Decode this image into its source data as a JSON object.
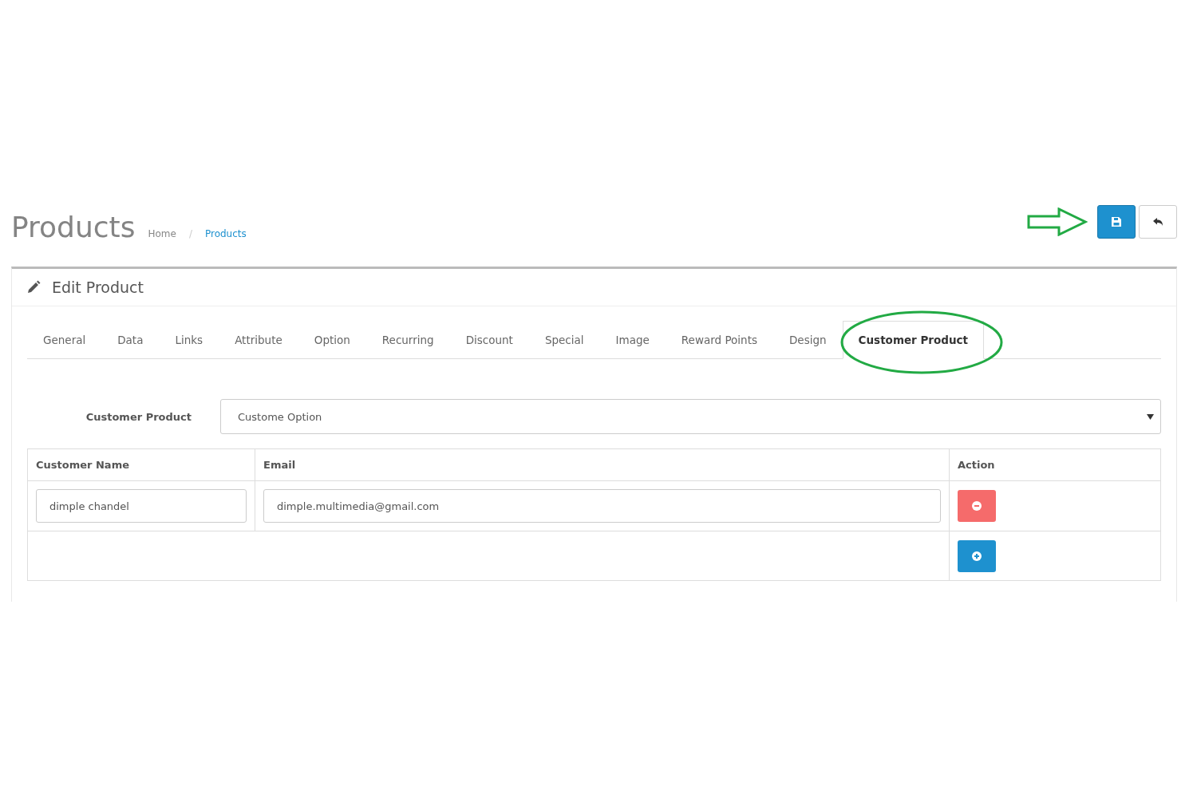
{
  "page": {
    "title": "Products",
    "breadcrumb_separator": "/",
    "breadcrumb": [
      {
        "label": "Home",
        "selected": false
      },
      {
        "label": "Products",
        "selected": true
      }
    ]
  },
  "panel": {
    "title": "Edit Product"
  },
  "tabs": [
    {
      "label": "General",
      "selected": false
    },
    {
      "label": "Data",
      "selected": false
    },
    {
      "label": "Links",
      "selected": false
    },
    {
      "label": "Attribute",
      "selected": false
    },
    {
      "label": "Option",
      "selected": false
    },
    {
      "label": "Recurring",
      "selected": false
    },
    {
      "label": "Discount",
      "selected": false
    },
    {
      "label": "Special",
      "selected": false
    },
    {
      "label": "Image",
      "selected": false
    },
    {
      "label": "Reward Points",
      "selected": false
    },
    {
      "label": "Design",
      "selected": false
    },
    {
      "label": "Customer Product",
      "selected": true
    }
  ],
  "form": {
    "label": "Customer Product",
    "select_value": "Custome Option"
  },
  "table": {
    "columns": [
      "Customer Name",
      "Email",
      "Action"
    ],
    "rows": [
      {
        "name": "dimple chandel",
        "email": "dimple.multimedia@gmail.com"
      }
    ]
  }
}
